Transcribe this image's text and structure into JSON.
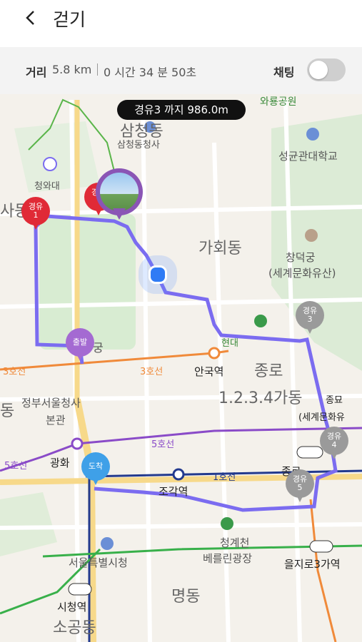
{
  "header": {
    "title": "걷기"
  },
  "stats": {
    "distance_label": "거리",
    "distance_value": "5.8 km",
    "time_value": "0 시간 34 분 50초",
    "chat_label": "채팅",
    "chat_toggle_on": false
  },
  "map": {
    "banner": "경유3 까지 986.0m",
    "pins": {
      "waypoint1": "경유\n1",
      "waypoint2": "경유",
      "start": "출발",
      "waypoint3": "경유\n3",
      "waypoint4": "경유\n4",
      "waypoint5": "경유\n5",
      "arrival": "도착"
    },
    "labels": {
      "wayong": "와룡공원",
      "samcheong": "삼청동",
      "samcheong_office": "삼청동청사",
      "cheongwadae": "청와대",
      "seonggyungwan": "성균관대학교",
      "gahoe": "가회동",
      "changdeok": "창덕궁",
      "heritage": "(세계문화유산)",
      "gung": "궁",
      "anguk": "안국역",
      "line3a": "3호선",
      "line3b": "3호선",
      "jongno": "종로",
      "jongno1234": "1.2.3.4가동",
      "jongmyo": "종묘",
      "jongmyo_heritage": "(세계문화유",
      "gov_complex": "정부서울청사",
      "gov_complex2": "본관",
      "line5a": "5호선",
      "line5b": "5호선",
      "gwanghwa": "광화",
      "jogak": "조각역",
      "line1": "1호선",
      "jongno3": "종로",
      "cheonggye": "청계천",
      "berlin": "베를린광장",
      "euljiro3": "을지로3가역",
      "seoul_hall": "서울특별시청",
      "cityhall": "시청역",
      "sogong": "소공동",
      "myeong": "명동",
      "hyundai": "현대",
      "left_dong": "사동",
      "dong2": "동"
    }
  },
  "colors": {
    "route": "#7b6cf0",
    "pin_red": "#e02a36",
    "pin_grey": "#9a9a9a",
    "pin_purple": "#a46ad2",
    "pin_blue": "#3fa0e8",
    "line3": "#f08a3a",
    "line5": "#8a4bc8",
    "line1": "#233a8e",
    "line2": "#38b04a"
  }
}
